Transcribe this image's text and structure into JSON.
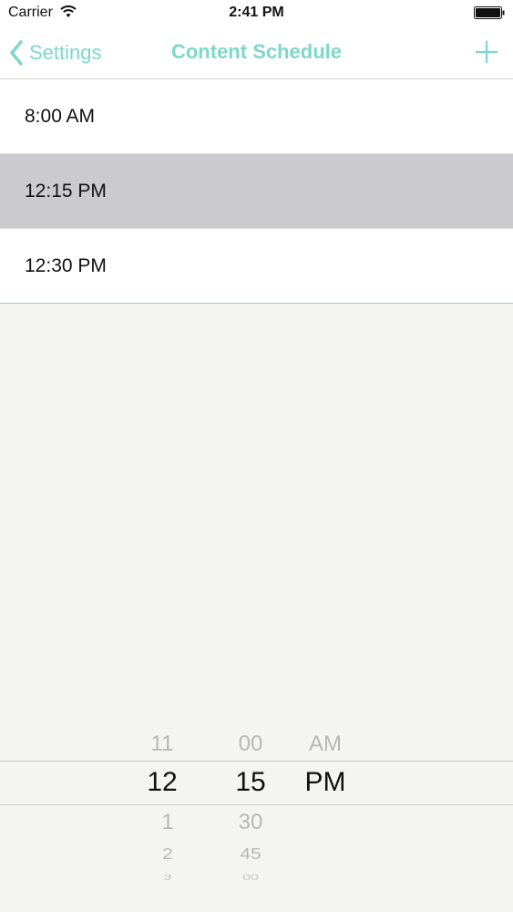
{
  "status_bar": {
    "carrier": "Carrier",
    "time": "2:41 PM",
    "icons": [
      "wifi-icon",
      "battery-icon"
    ]
  },
  "nav": {
    "back_label": "Settings",
    "title": "Content Schedule",
    "add_icon": "plus-icon"
  },
  "schedule": {
    "items": [
      {
        "label": "8:00 AM",
        "selected": false
      },
      {
        "label": "12:15 PM",
        "selected": true
      },
      {
        "label": "12:30 PM",
        "selected": false
      }
    ]
  },
  "picker": {
    "hours": [
      "11",
      "12",
      "1",
      "2",
      "3"
    ],
    "minutes": [
      "00",
      "15",
      "30",
      "45",
      "00"
    ],
    "periods": [
      "AM",
      "PM"
    ],
    "selected_hour": "12",
    "selected_minute": "15",
    "selected_period": "PM"
  },
  "colors": {
    "accent": "#7dd8c8",
    "selected_row": "#cbcbcd",
    "background": "#f4f5f3"
  }
}
